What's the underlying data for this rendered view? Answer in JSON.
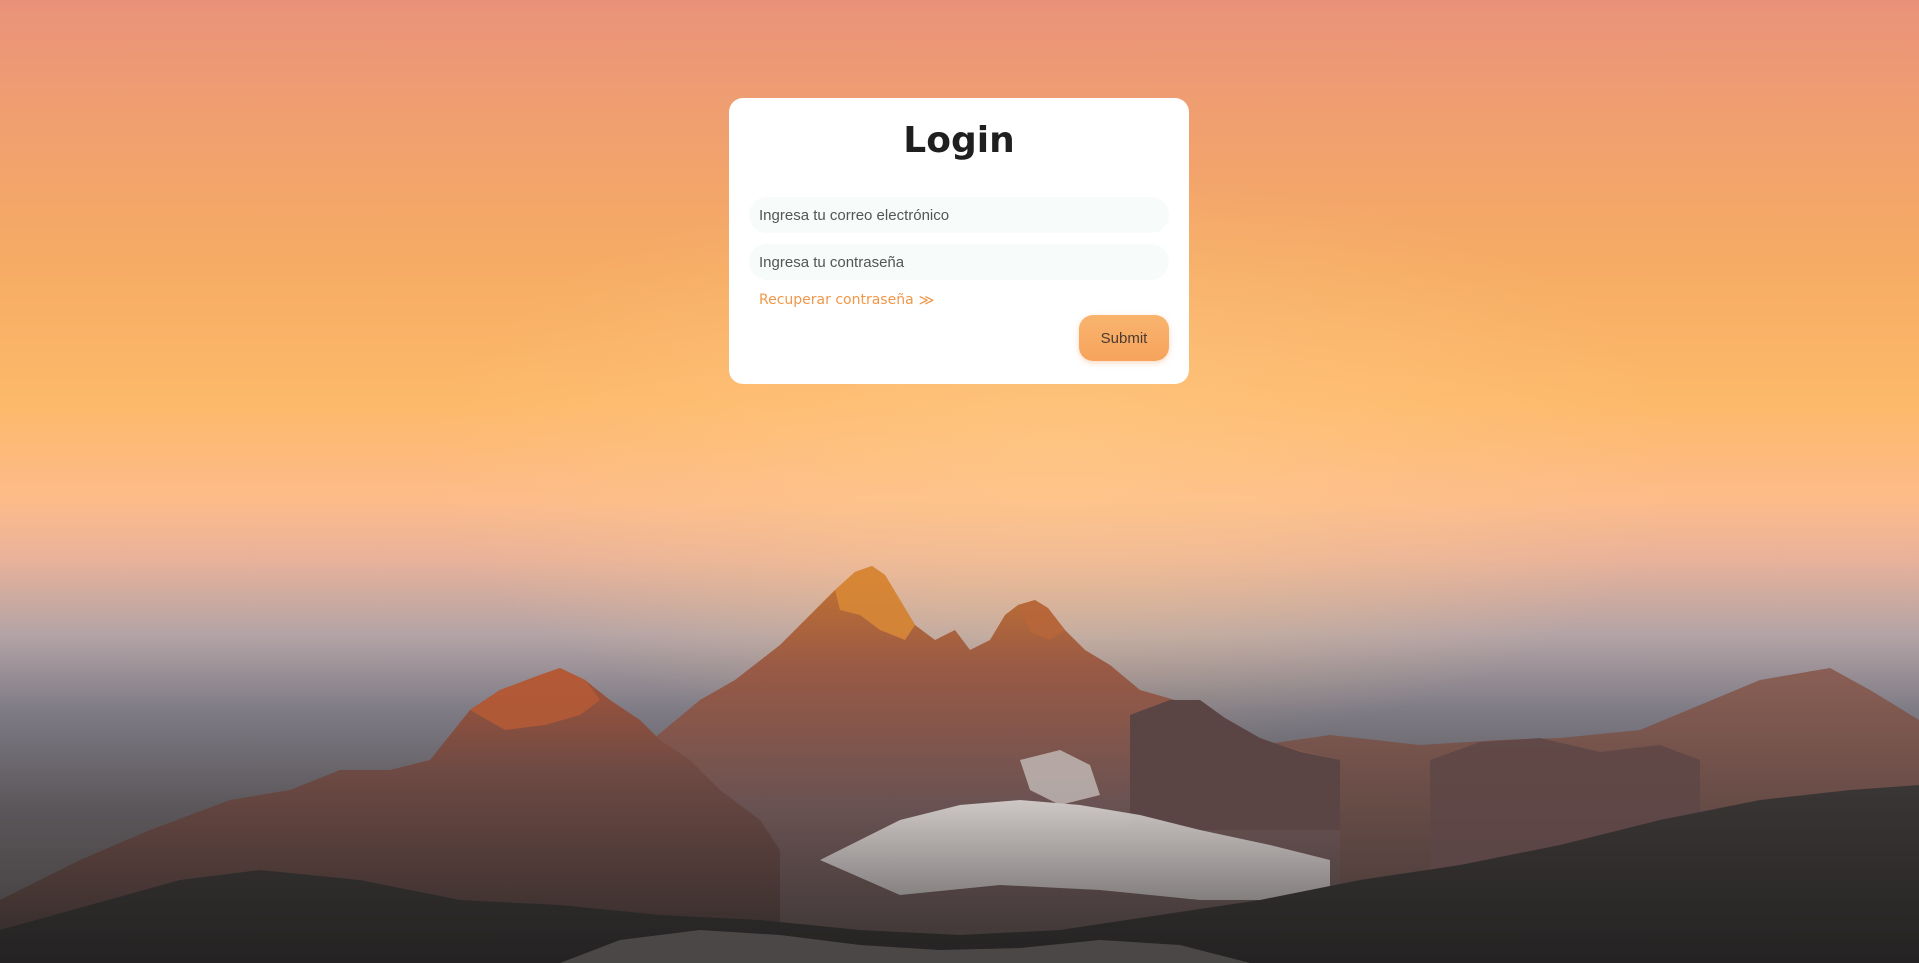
{
  "page": {
    "background_scene": "mountain-sunset",
    "accent_color": "#f0974a",
    "button_color": "#f6a35c"
  },
  "login": {
    "title": "Login",
    "email_placeholder": "Ingresa tu correo electrónico",
    "email_value": "",
    "password_placeholder": "Ingresa tu contraseña",
    "password_value": "",
    "recover_label": "Recuperar contraseña",
    "recover_icon": "double-chevron-right-icon",
    "submit_label": "Submit"
  }
}
